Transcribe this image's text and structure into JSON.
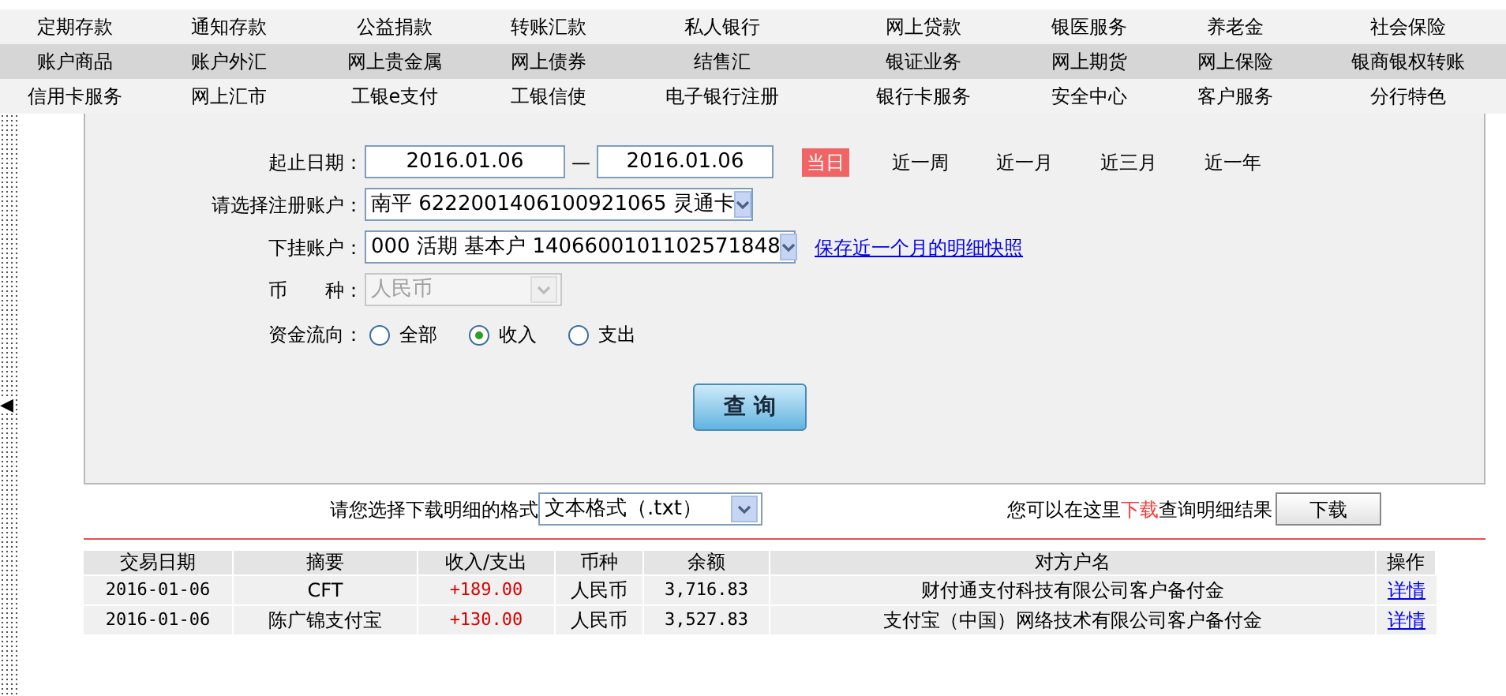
{
  "menu_rows": [
    [
      "定期存款",
      "通知存款",
      "公益捐款",
      "转账汇款",
      "私人银行",
      "网上贷款",
      "银医服务",
      "养老金",
      "社会保险"
    ],
    [
      "账户商品",
      "账户外汇",
      "网上贵金属",
      "网上债券",
      "结售汇",
      "银证业务",
      "网上期货",
      "网上保险",
      "银商银权转账"
    ],
    [
      "信用卡服务",
      "网上汇市",
      "工银e支付",
      "工银信使",
      "电子银行注册",
      "银行卡服务",
      "安全中心",
      "客户服务",
      "分行特色"
    ]
  ],
  "sidebar_toggle": "◀",
  "form": {
    "date_label": "起止日期：",
    "date_from": "2016.01.06",
    "date_separator": "—",
    "date_to": "2016.01.06",
    "ranges": [
      {
        "label": "当日",
        "selected": true
      },
      {
        "label": "近一周",
        "selected": false
      },
      {
        "label": "近一月",
        "selected": false
      },
      {
        "label": "近三月",
        "selected": false
      },
      {
        "label": "近一年",
        "selected": false
      }
    ],
    "account_label": "请选择注册账户：",
    "account": {
      "value": "南平 6222001406100921065 灵通卡",
      "disabled": false
    },
    "sub_account_label": "下挂账户：",
    "sub_account": {
      "value": "000 活期 基本户 1406600101102571848",
      "disabled": false
    },
    "snapshot_link": "保存近一个月的明细快照",
    "currency_label": "币　　种：",
    "currency": {
      "value": "人民币",
      "disabled": true
    },
    "flow_label": "资金流向：",
    "flow_options": [
      {
        "label": "全部",
        "selected": false
      },
      {
        "label": "收入",
        "selected": true
      },
      {
        "label": "支出",
        "selected": false
      }
    ],
    "query_button": "查 询"
  },
  "download": {
    "format_label": "请您选择下载明细的格式",
    "format": {
      "value": "文本格式（.txt）",
      "disabled": false
    },
    "hint_before": "您可以在这里",
    "hint_highlight": "下载",
    "hint_after": "查询明细结果",
    "button": "下载"
  },
  "table": {
    "columns": [
      "交易日期",
      "摘要",
      "收入/支出",
      "币种",
      "余额",
      "对方户名",
      "操作"
    ],
    "rows": [
      {
        "date": "2016-01-06",
        "summary": "CFT",
        "amount": "+189.00",
        "currency": "人民币",
        "balance": "3,716.83",
        "counterparty": "财付通支付科技有限公司客户备付金",
        "action": "详情"
      },
      {
        "date": "2016-01-06",
        "summary": "陈广锦支付宝",
        "amount": "+130.00",
        "currency": "人民币",
        "balance": "3,527.83",
        "counterparty": "支付宝（中国）网络技术有限公司客户备付金",
        "action": "详情"
      }
    ]
  }
}
